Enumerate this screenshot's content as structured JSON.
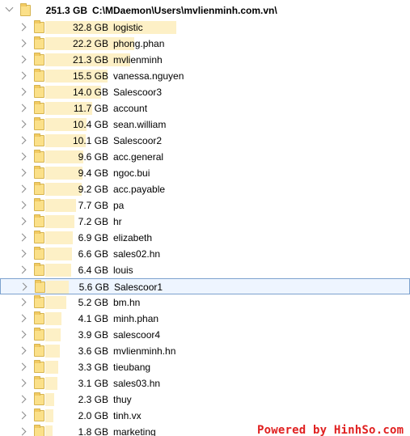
{
  "root": {
    "size": "251.3 GB",
    "path": "C:\\MDaemon\\Users\\mvlienminh.com.vn\\"
  },
  "max_size_gb": 32.8,
  "items": [
    {
      "size": "32.8 GB",
      "gb": 32.8,
      "name": "logistic"
    },
    {
      "size": "22.2 GB",
      "gb": 22.2,
      "name": "phong.phan"
    },
    {
      "size": "21.3 GB",
      "gb": 21.3,
      "name": "mvlienminh"
    },
    {
      "size": "15.5 GB",
      "gb": 15.5,
      "name": "vanessa.nguyen"
    },
    {
      "size": "14.0 GB",
      "gb": 14.0,
      "name": "Salescoor3"
    },
    {
      "size": "11.7 GB",
      "gb": 11.7,
      "name": "account"
    },
    {
      "size": "10.4 GB",
      "gb": 10.4,
      "name": "sean.william"
    },
    {
      "size": "10.1 GB",
      "gb": 10.1,
      "name": "Salescoor2"
    },
    {
      "size": "9.6 GB",
      "gb": 9.6,
      "name": "acc.general"
    },
    {
      "size": "9.4 GB",
      "gb": 9.4,
      "name": "ngoc.bui"
    },
    {
      "size": "9.2 GB",
      "gb": 9.2,
      "name": "acc.payable"
    },
    {
      "size": "7.7 GB",
      "gb": 7.7,
      "name": "pa"
    },
    {
      "size": "7.2 GB",
      "gb": 7.2,
      "name": "hr"
    },
    {
      "size": "6.9 GB",
      "gb": 6.9,
      "name": "elizabeth"
    },
    {
      "size": "6.6 GB",
      "gb": 6.6,
      "name": "sales02.hn"
    },
    {
      "size": "6.4 GB",
      "gb": 6.4,
      "name": "louis"
    },
    {
      "size": "5.6 GB",
      "gb": 5.6,
      "name": "Salescoor1",
      "selected": true
    },
    {
      "size": "5.2 GB",
      "gb": 5.2,
      "name": "bm.hn"
    },
    {
      "size": "4.1 GB",
      "gb": 4.1,
      "name": "minh.phan"
    },
    {
      "size": "3.9 GB",
      "gb": 3.9,
      "name": "salescoor4"
    },
    {
      "size": "3.6 GB",
      "gb": 3.6,
      "name": "mvlienminh.hn"
    },
    {
      "size": "3.3 GB",
      "gb": 3.3,
      "name": "tieubang"
    },
    {
      "size": "3.1 GB",
      "gb": 3.1,
      "name": "sales03.hn"
    },
    {
      "size": "2.3 GB",
      "gb": 2.3,
      "name": "thuy"
    },
    {
      "size": "2.0 GB",
      "gb": 2.0,
      "name": "tinh.vx"
    },
    {
      "size": "1.8 GB",
      "gb": 1.8,
      "name": "marketing"
    }
  ],
  "watermark": "Powered by HinhSo.com",
  "colors": {
    "bar": "#fdf0c6",
    "folder": "#fbe089",
    "selection": "#eef5ff",
    "watermark": "#e02020"
  }
}
